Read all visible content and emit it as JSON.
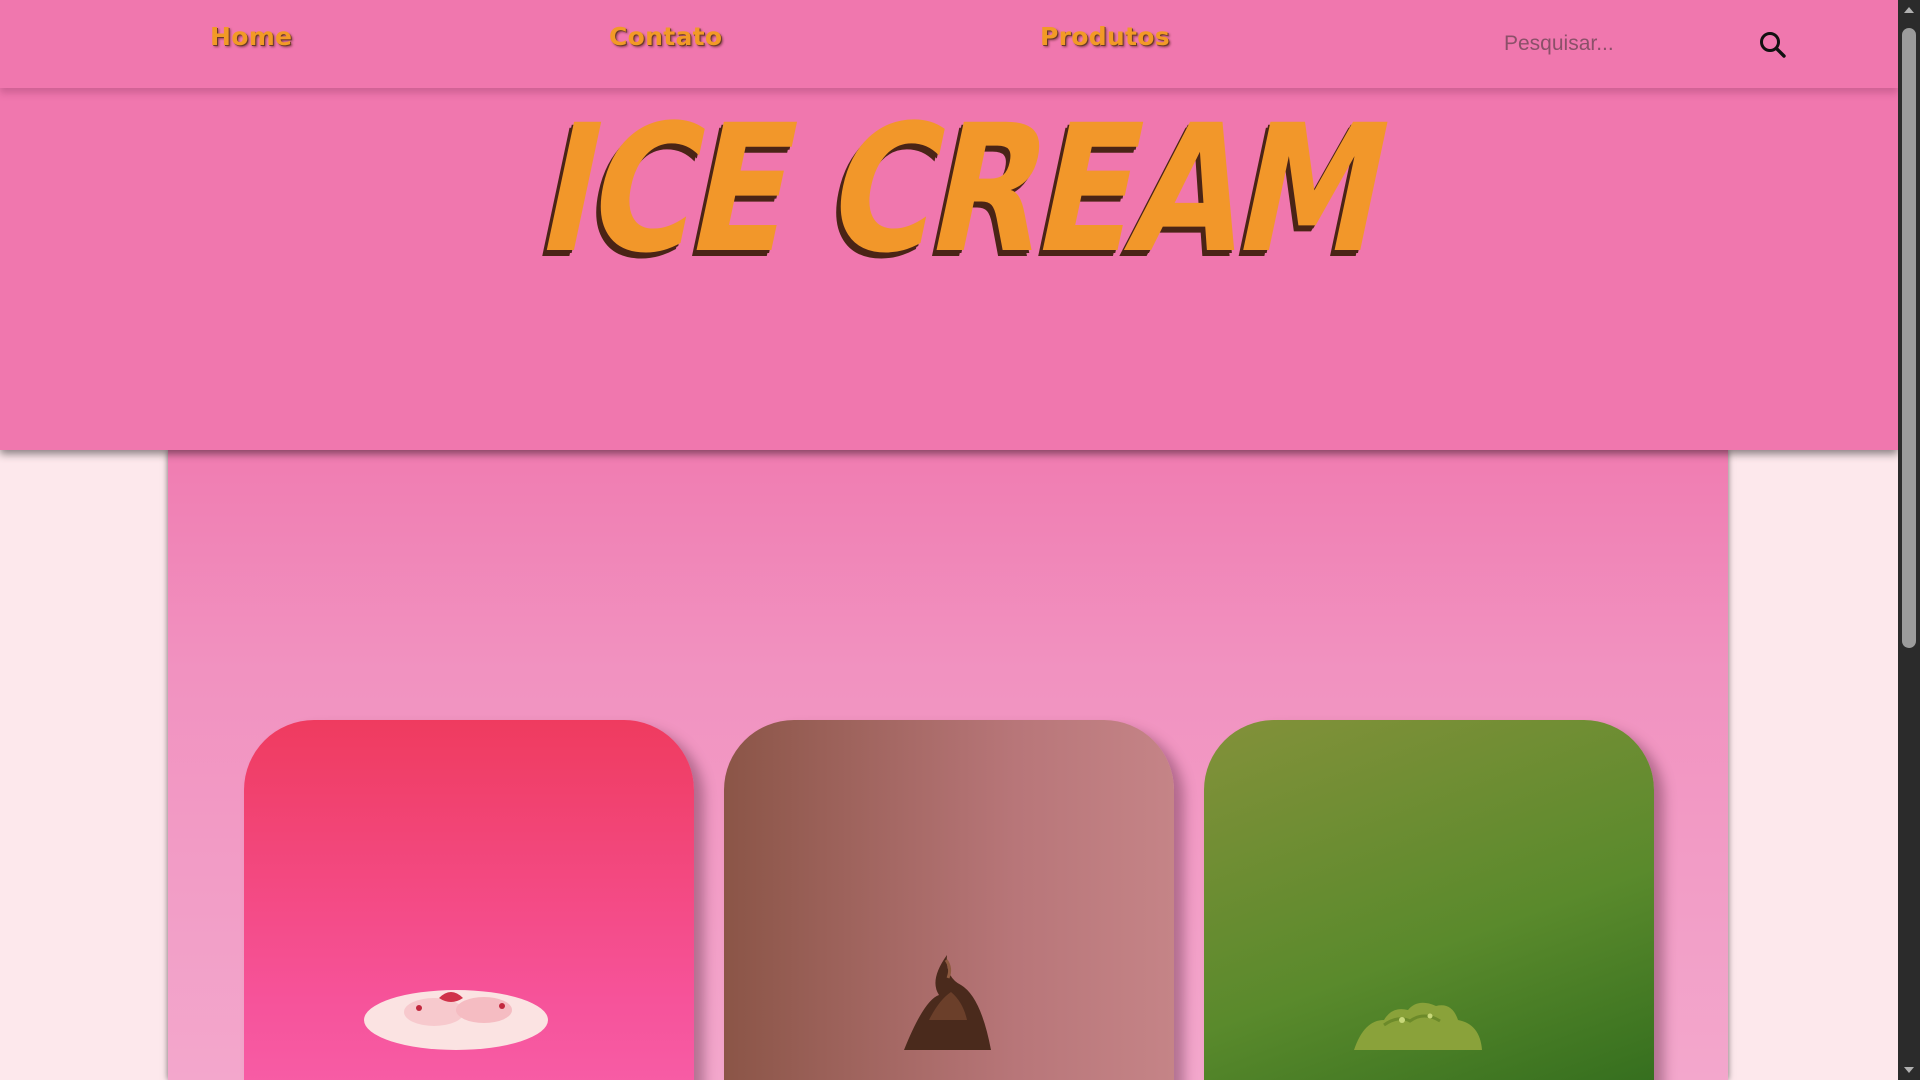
{
  "nav": {
    "home_label": "Home",
    "contato_label": "Contato",
    "produtos_label": "Produtos"
  },
  "search": {
    "placeholder": "Pesquisar...",
    "icon": "search-icon"
  },
  "hero": {
    "logo_text": "ICE CREAM"
  },
  "products": [
    {
      "flavor_icon": "strawberry-ice-cream-image",
      "accent": "#f6539a"
    },
    {
      "flavor_icon": "chocolate-ice-cream-image",
      "accent": "#b87679"
    },
    {
      "flavor_icon": "pistachio-ice-cream-image",
      "accent": "#5a8a2c"
    }
  ],
  "colors": {
    "header_bg": "#f077ae",
    "brand_orange": "#f2972a",
    "page_bg": "#fde8ec"
  }
}
